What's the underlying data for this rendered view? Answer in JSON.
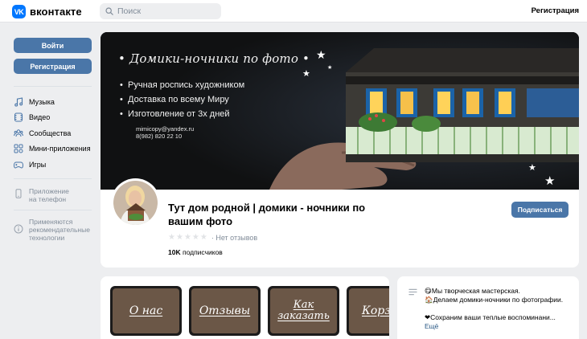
{
  "header": {
    "logo_mark": "VK",
    "logo_text": "вконтакте",
    "search_placeholder": "Поиск",
    "register_link": "Регистрация"
  },
  "sidebar": {
    "login_button": "Войти",
    "register_button": "Регистрация",
    "items": [
      {
        "label": "Музыка",
        "icon": "music-icon"
      },
      {
        "label": "Видео",
        "icon": "video-icon"
      },
      {
        "label": "Сообщества",
        "icon": "communities-icon"
      },
      {
        "label": "Мини-приложения",
        "icon": "mini-apps-icon"
      },
      {
        "label": "Игры",
        "icon": "gamepad-icon"
      }
    ],
    "app_line1": "Приложение",
    "app_line2": "на телефон",
    "tech_line1": "Применяются",
    "tech_line2": "рекомендательные",
    "tech_line3": "технологии"
  },
  "cover": {
    "title": "• Домики-ночники по фото •",
    "bullets": [
      "Ручная роспись художником",
      "Доставка по всему Миру",
      "Изготовление от 3х дней"
    ],
    "email": "mimicopy@yandex.ru",
    "phone": "8(982) 820 22 10"
  },
  "profile": {
    "name": "Тут дом родной | домики - ночники по вашим фото",
    "reviews": "· Нет отзывов",
    "rating_stars": 0,
    "subscribers_count": "10K",
    "subscribers_label": "подписчиков",
    "subscribe_button": "Подписаться"
  },
  "menu": [
    {
      "label": "О нас"
    },
    {
      "label": "Отзывы"
    },
    {
      "label": "Как заказать"
    },
    {
      "label": "Корзина"
    }
  ],
  "info": {
    "line1": "😋Мы творческая мастерская.",
    "line2": "🏠Делаем домики-ночники по фотографии.",
    "line3": "❤Сохраним ваши теплые воспоминани...",
    "more": "Ещё"
  },
  "colors": {
    "accent": "#4a76a8",
    "brand": "#0077ff",
    "background": "#edeef0"
  }
}
